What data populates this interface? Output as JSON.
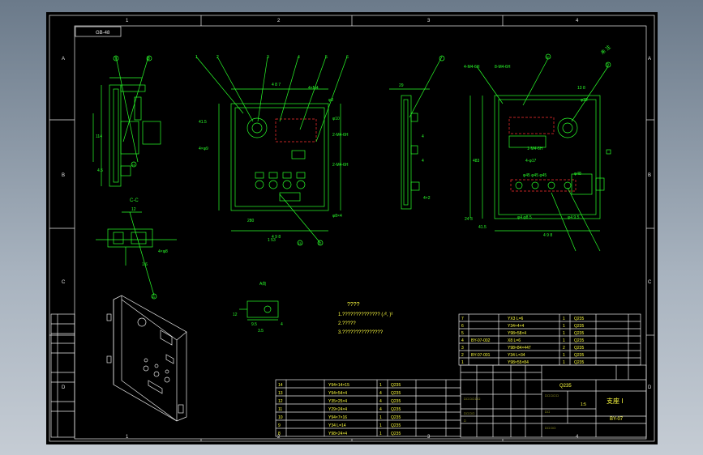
{
  "colors": {
    "background_top": "#6b7a8a",
    "paper": "#000000",
    "frame": "#e8e8e8",
    "geometry": "#2aff2a",
    "text": "#ffff40",
    "hidden": "#ff3030"
  },
  "frame": {
    "zones_top": [
      "1",
      "2",
      "3",
      "4"
    ],
    "zones_side": [
      "A",
      "B",
      "C",
      "D"
    ],
    "corner_code": "GB-48"
  },
  "views": {
    "section_cc": "C-C",
    "section_a": "A向",
    "leader_numbers_left": [
      "7",
      "8",
      "14",
      "11"
    ],
    "leader_numbers_front": [
      "1",
      "2",
      "3",
      "4",
      "5",
      "6"
    ],
    "leader_numbers_right": [
      "9",
      "10",
      "12",
      "13"
    ],
    "dim_width": "4 8 7",
    "dim_overall": "4 9 8",
    "dim_cc": "12",
    "roughness": "未 注"
  },
  "notes": {
    "title": "????",
    "lines": [
      "1.?????????????? ( ⁄², )²",
      "2.?????",
      "3.???????????????"
    ]
  },
  "upper_table": [
    [
      "7",
      "",
      "YX3 L=6",
      "1",
      "Q235"
    ],
    [
      "6",
      "",
      "Y34×4×4",
      "1",
      "Q235"
    ],
    [
      "5",
      "",
      "Y98×58×4",
      "1",
      "Q235"
    ],
    [
      "4",
      "BY-07-002",
      "X8 L=6",
      "1",
      "Q235"
    ],
    [
      "3",
      "",
      "Y98×84×447",
      "2",
      "Q235"
    ],
    [
      "2",
      "BY-07-001",
      "Y34 L=34",
      "1",
      "Q235"
    ],
    [
      "1",
      "",
      "Y98×55×84",
      "1",
      "Q235"
    ]
  ],
  "lower_table": [
    [
      "14",
      "",
      "Y94×14×15",
      "1",
      "Q235"
    ],
    [
      "13",
      "",
      "Y94×54×4",
      "4",
      "Q235"
    ],
    [
      "12",
      "",
      "Y35×25×4",
      "4",
      "Q235"
    ],
    [
      "11",
      "",
      "Y29×24×4",
      "4",
      "Q235"
    ],
    [
      "10",
      "",
      "Y94×7×16",
      "1",
      "Q235"
    ],
    [
      "9",
      "",
      "Y34 L=14",
      "1",
      "Q235"
    ],
    [
      "8",
      "",
      "Y98×24×4",
      "1",
      "Q235"
    ]
  ],
  "title_block": {
    "material": "Q235",
    "drawing_name": "支座 I",
    "drawing_code": "BY-07",
    "scale": "1:5"
  },
  "left_strip": [
    "",
    "",
    "",
    "",
    "",
    ""
  ]
}
